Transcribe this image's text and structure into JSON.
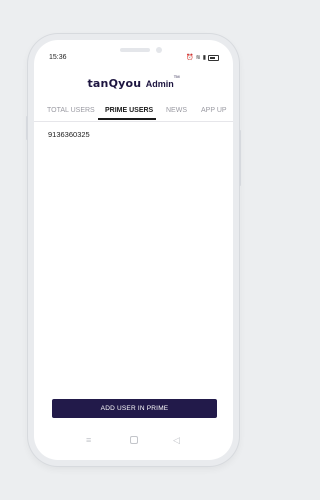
{
  "status_bar": {
    "time": "15:36"
  },
  "app": {
    "brand": "tanQyou",
    "suffix": "Admin",
    "trademark": "TM"
  },
  "tabs": [
    {
      "label": "TOTAL USERS",
      "active": false
    },
    {
      "label": "PRIME USERS",
      "active": true
    },
    {
      "label": "NEWS",
      "active": false
    },
    {
      "label": "APP UP",
      "active": false
    }
  ],
  "prime_users": [
    "9136360325"
  ],
  "actions": {
    "add_user_label": "ADD USER IN PRIME"
  },
  "colors": {
    "primary_button": "#221a4a",
    "background": "#eceef0"
  },
  "icons": {
    "status": [
      "alarm-icon",
      "wifi-icon",
      "signal-icon",
      "battery-icon"
    ],
    "nav": [
      "menu-icon",
      "home-icon",
      "back-icon"
    ]
  }
}
